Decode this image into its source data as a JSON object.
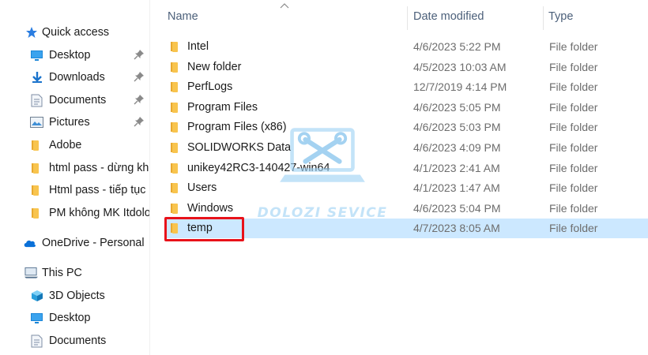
{
  "navigation": {
    "quick_access": {
      "label": "Quick access",
      "items": [
        {
          "label": "Desktop",
          "icon": "desktop-icon",
          "pinned": true
        },
        {
          "label": "Downloads",
          "icon": "download-icon",
          "pinned": true
        },
        {
          "label": "Documents",
          "icon": "documents-icon",
          "pinned": true
        },
        {
          "label": "Pictures",
          "icon": "pictures-icon",
          "pinned": true
        },
        {
          "label": "Adobe",
          "icon": "folder-icon",
          "pinned": false
        },
        {
          "label": "html pass - dừng kh",
          "icon": "folder-icon",
          "pinned": false
        },
        {
          "label": "Html pass - tiếp tục",
          "icon": "folder-icon",
          "pinned": false
        },
        {
          "label": "PM không MK Itdolo",
          "icon": "folder-icon",
          "pinned": false
        }
      ]
    },
    "onedrive": {
      "label": "OneDrive - Personal",
      "icon": "cloud-icon"
    },
    "this_pc": {
      "label": "This PC",
      "icon": "computer-icon",
      "items": [
        {
          "label": "3D Objects",
          "icon": "cube-icon"
        },
        {
          "label": "Desktop",
          "icon": "desktop-icon"
        },
        {
          "label": "Documents",
          "icon": "documents-icon"
        }
      ]
    }
  },
  "columns": {
    "name": "Name",
    "date_modified": "Date modified",
    "type": "Type"
  },
  "files": [
    {
      "name": "Intel",
      "date": "4/6/2023 5:22 PM",
      "type": "File folder"
    },
    {
      "name": "New folder",
      "date": "4/5/2023 10:03 AM",
      "type": "File folder"
    },
    {
      "name": "PerfLogs",
      "date": "12/7/2019 4:14 PM",
      "type": "File folder"
    },
    {
      "name": "Program Files",
      "date": "4/6/2023 5:05 PM",
      "type": "File folder"
    },
    {
      "name": "Program Files (x86)",
      "date": "4/6/2023 5:03 PM",
      "type": "File folder"
    },
    {
      "name": "SOLIDWORKS Data",
      "date": "4/6/2023 4:09 PM",
      "type": "File folder"
    },
    {
      "name": "unikey42RC3-140427-win64",
      "date": "4/1/2023 2:41 AM",
      "type": "File folder"
    },
    {
      "name": "Users",
      "date": "4/1/2023 1:47 AM",
      "type": "File folder"
    },
    {
      "name": "Windows",
      "date": "4/6/2023 5:04 PM",
      "type": "File folder"
    },
    {
      "name": "temp",
      "date": "4/7/2023 8:05 AM",
      "type": "File folder",
      "selected": true
    }
  ],
  "watermark": {
    "text": "DOLOZI SEVICE",
    "icon": "laptop-tools-icon"
  },
  "colors": {
    "selection": "#cce8ff",
    "highlight_box": "#e8121a",
    "folder": "#f8c44e",
    "header_text": "#4c607a",
    "accent_blue": "#0a70d8"
  }
}
